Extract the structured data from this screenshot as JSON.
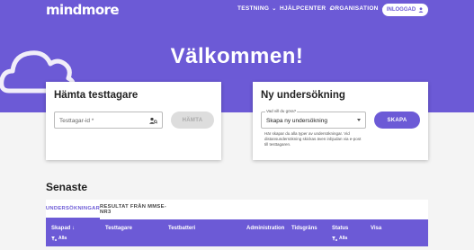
{
  "header": {
    "logo": "mindmore",
    "nav": [
      "TESTNING",
      "HJÄLPCENTER",
      "ORGANISATION"
    ],
    "login_label": "INLOGGAD"
  },
  "hero": {
    "title": "Välkommen!"
  },
  "card_test": {
    "title": "Hämta testtagare",
    "input_placeholder": "Testtagar-id *",
    "button_label": "HÄMTA"
  },
  "card_survey": {
    "title": "Ny undersökning",
    "select_legend": "Vad vill du göra?",
    "select_value": "Skapa ny undersökning",
    "helper": "Här skapar du alla typer av undersökningar. Vid distansundersökning skickas även inbjudan via e-post till testtagaren.",
    "button_label": "SKAPA"
  },
  "recent": {
    "title": "Senaste",
    "tabs": [
      "UNDERSÖKNINGAR",
      "RESULTAT FRÅN MMSE-NR3"
    ],
    "columns": [
      "Skapad",
      "Testtagare",
      "Testbatteri",
      "Administration",
      "Tidsgräns",
      "Status",
      "Visa"
    ],
    "filter_label": "Alla"
  },
  "colors": {
    "accent": "#6c5ad6"
  }
}
